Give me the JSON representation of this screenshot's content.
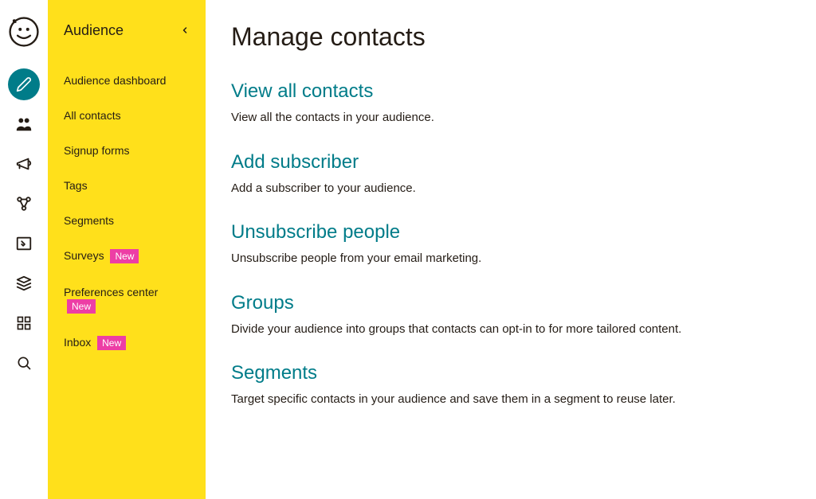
{
  "colors": {
    "accent": "#007c89",
    "sidebar_bg": "#ffe01b",
    "badge_bg": "#ed3ea5",
    "text": "#241c15"
  },
  "sidebar": {
    "title": "Audience",
    "items": [
      {
        "label": "Audience dashboard",
        "badge": null
      },
      {
        "label": "All contacts",
        "badge": null
      },
      {
        "label": "Signup forms",
        "badge": null
      },
      {
        "label": "Tags",
        "badge": null
      },
      {
        "label": "Segments",
        "badge": null
      },
      {
        "label": "Surveys",
        "badge": "New"
      },
      {
        "label": "Preferences center",
        "badge": "New"
      },
      {
        "label": "Inbox",
        "badge": "New"
      }
    ]
  },
  "main": {
    "title": "Manage contacts",
    "sections": [
      {
        "title": "View all contacts",
        "desc": "View all the contacts in your audience."
      },
      {
        "title": "Add subscriber",
        "desc": "Add a subscriber to your audience."
      },
      {
        "title": "Unsubscribe people",
        "desc": "Unsubscribe people from your email marketing."
      },
      {
        "title": "Groups",
        "desc": "Divide your audience into groups that contacts can opt-in to for more tailored content."
      },
      {
        "title": "Segments",
        "desc": "Target specific contacts in your audience and save them in a segment to reuse later."
      }
    ]
  }
}
